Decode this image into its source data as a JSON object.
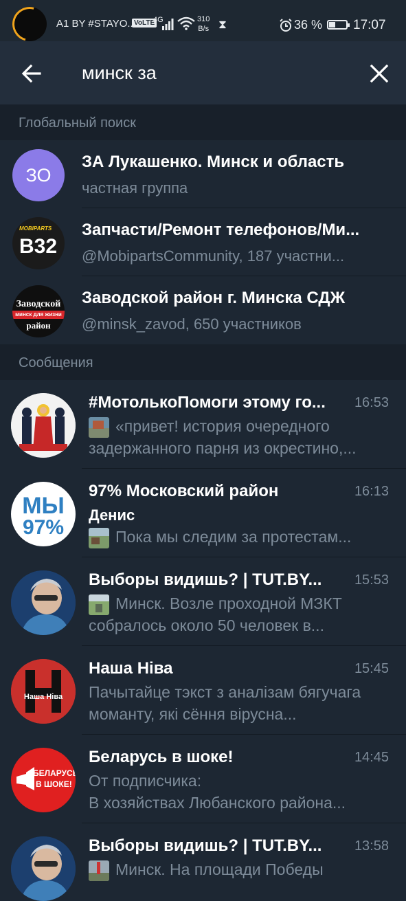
{
  "status_bar": {
    "carrier": "A1 BY #STAYO...",
    "volte": "VoLTE",
    "network": "4G",
    "speed_value": "310",
    "speed_unit": "B/s",
    "battery_percent": "36 %",
    "battery_level": 0.36,
    "time": "17:07"
  },
  "search": {
    "query": "минск за",
    "back_icon": "arrow-left-icon",
    "clear_icon": "close-icon"
  },
  "sections": {
    "global": "Глобальный поиск",
    "messages": "Сообщения"
  },
  "global_results": [
    {
      "title": "ЗА Лукашенко. Минск и область",
      "subtitle": "частная группа",
      "avatar_text": "ЗО",
      "avatar_color": "#8b7be8"
    },
    {
      "title": "Запчасти/Ремонт телефонов/Ми...",
      "subtitle": "@MobipartsCommunity, 187 участни...",
      "avatar_brand": "MOBIPARTS",
      "avatar_text": "B32"
    },
    {
      "title": "Заводской район г. Минска СДЖ",
      "subtitle": "@minsk_zavod, 650 участников",
      "avatar_text": "Заводской",
      "avatar_band": "минск для жизни",
      "avatar_text2": "район"
    }
  ],
  "messages": [
    {
      "title": "#МотолькоПомоги этому го...",
      "time": "16:53",
      "line1": "«привет! история очередного",
      "line2": "задержанного парня из окрестино,..."
    },
    {
      "title": "97% Московский район",
      "time": "16:13",
      "sender": "Денис",
      "line1": "Пока мы следим за протестам...",
      "avatar_text": "МЫ",
      "avatar_text2": "97%"
    },
    {
      "title": "Выборы видишь? | TUT.BY...",
      "time": "15:53",
      "line1": "Минск. Возле проходной МЗКТ",
      "line2": "собралось около 50 человек в..."
    },
    {
      "title": "Наша Ніва",
      "time": "15:45",
      "line1": "Пачытайце тэкст з аналізам бягучага",
      "line2": "моманту, які сёння вірусна...",
      "avatar_text": "Наша Ніва"
    },
    {
      "title": "Беларусь в шоке!",
      "time": "14:45",
      "line1": "От подписчика:",
      "line2": "В хозяйствах Любанского района...",
      "avatar_text": "БЕЛАРУСЬ",
      "avatar_text2": "В ШОКЕ!"
    },
    {
      "title": "Выборы видишь? | TUT.BY...",
      "time": "13:58",
      "line1": "Минск. На площади Победы"
    }
  ]
}
